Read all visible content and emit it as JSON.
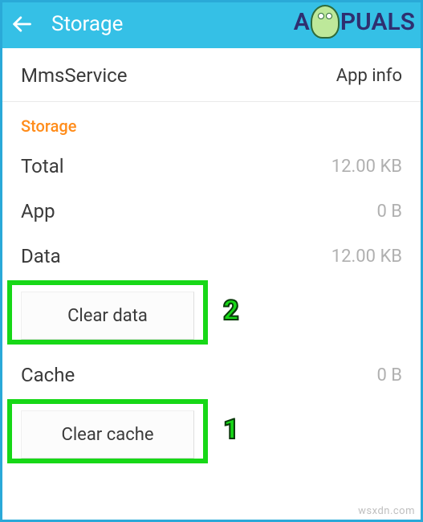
{
  "header": {
    "title": "Storage"
  },
  "logo": {
    "text_before": "A",
    "text_after": "PUALS"
  },
  "app": {
    "name": "MmsService",
    "info_label": "App info"
  },
  "section": {
    "title": "Storage"
  },
  "rows": {
    "total": {
      "label": "Total",
      "value": "12.00 KB"
    },
    "app": {
      "label": "App",
      "value": "0 B"
    },
    "data": {
      "label": "Data",
      "value": "12.00 KB"
    },
    "cache": {
      "label": "Cache",
      "value": "0 B"
    }
  },
  "buttons": {
    "clear_data": "Clear data",
    "clear_cache": "Clear cache"
  },
  "annotations": {
    "badge_data": "2",
    "badge_cache": "1"
  },
  "watermark": "wsxdn.com"
}
